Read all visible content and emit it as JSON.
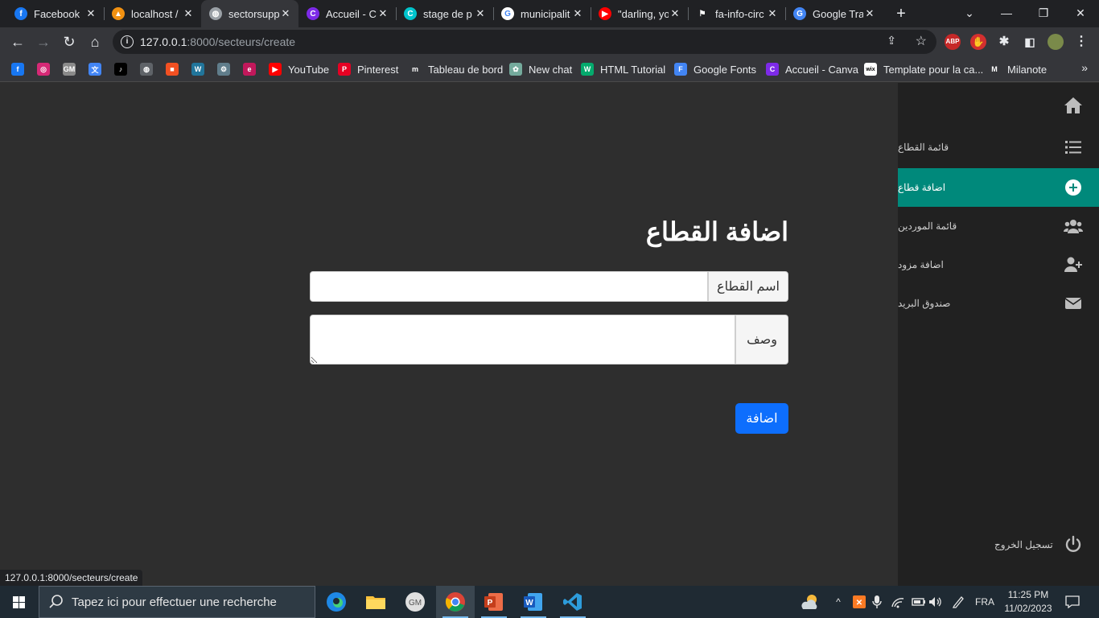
{
  "browser": {
    "tabs": [
      {
        "title": "Facebook",
        "icon": "facebook-icon",
        "color": "#1877f2",
        "glyph": "f"
      },
      {
        "title": "localhost /",
        "icon": "phpmyadmin-icon",
        "color": "#f29111",
        "glyph": "▲"
      },
      {
        "title": "sectorsupp",
        "icon": "globe-icon",
        "color": "#9aa0a6",
        "glyph": "◍",
        "active": true
      },
      {
        "title": "Accueil - C",
        "icon": "canva-icon",
        "color": "#7d2ae8",
        "glyph": "C"
      },
      {
        "title": "stage de p",
        "icon": "canva-icon",
        "color": "#00c4cc",
        "glyph": "C"
      },
      {
        "title": "municipalit",
        "icon": "google-icon",
        "color": "#ffffff",
        "glyph": "G"
      },
      {
        "title": "\"darling, yo",
        "icon": "youtube-icon",
        "color": "#ff0000",
        "glyph": "▶"
      },
      {
        "title": "fa-info-circ",
        "icon": "flag-icon",
        "color": "#202124",
        "glyph": "⚑"
      },
      {
        "title": "Google Tra",
        "icon": "google-translate-icon",
        "color": "#4285f4",
        "glyph": "G"
      }
    ],
    "url": {
      "host": "127.0.0.1",
      "rest": ":8000/secteurs/create"
    },
    "bookmark_icons": [
      {
        "icon": "facebook-icon",
        "color": "#1877f2",
        "glyph": "f"
      },
      {
        "icon": "instagram-icon",
        "color": "#d62976",
        "glyph": "◎"
      },
      {
        "icon": "gmail-icon",
        "color": "#8a8a8a",
        "glyph": "GM"
      },
      {
        "icon": "translate-icon",
        "color": "#4285f4",
        "glyph": "文"
      },
      {
        "icon": "tiktok-icon",
        "color": "#000000",
        "glyph": "♪"
      },
      {
        "icon": "globe-icon",
        "color": "#5f6368",
        "glyph": "◍"
      },
      {
        "icon": "microsoft-icon",
        "color": "#f25022",
        "glyph": "■"
      },
      {
        "icon": "wordpress-icon",
        "color": "#21759b",
        "glyph": "W"
      },
      {
        "icon": "tool-icon",
        "color": "#607d8b",
        "glyph": "⚙"
      },
      {
        "icon": "app-icon",
        "color": "#c2185b",
        "glyph": "e"
      }
    ],
    "bookmarks": [
      {
        "label": "YouTube",
        "icon": "youtube-icon",
        "color": "#ff0000",
        "glyph": "▶"
      },
      {
        "label": "Pinterest",
        "icon": "pinterest-icon",
        "color": "#e60023",
        "glyph": "P"
      },
      {
        "label": "Tableau de bord",
        "icon": "dashboard-icon",
        "color": "#35363a",
        "glyph": "m"
      },
      {
        "label": "New chat",
        "icon": "chatgpt-icon",
        "color": "#74aa9c",
        "glyph": "✿"
      },
      {
        "label": "HTML Tutorial",
        "icon": "w3schools-icon",
        "color": "#04aa6d",
        "glyph": "W"
      },
      {
        "label": "Google Fonts",
        "icon": "google-fonts-icon",
        "color": "#4285f4",
        "glyph": "F"
      },
      {
        "label": "Accueil - Canva",
        "icon": "canva-icon",
        "color": "#7d2ae8",
        "glyph": "C"
      },
      {
        "label": "Template pour la ca...",
        "icon": "wix-icon",
        "color": "#ffffff",
        "glyph": "wix"
      },
      {
        "label": "Milanote",
        "icon": "milanote-icon",
        "color": "#35363a",
        "glyph": "M"
      }
    ]
  },
  "page": {
    "title": "اضافة القطاع",
    "form": {
      "name_label": "اسم القطاع",
      "name_value": "",
      "desc_label": "وصف",
      "desc_value": "",
      "submit_label": "اضافة"
    },
    "status_url": "127.0.0.1:8000/secteurs/create"
  },
  "sidebar": {
    "items": [
      {
        "label": "قائمة القطاع",
        "icon": "list-icon"
      },
      {
        "label": "اضافة قطاع",
        "icon": "plus-circle-icon",
        "active": true
      },
      {
        "label": "قائمة الموردين",
        "icon": "users-icon"
      },
      {
        "label": "اضافة مزود",
        "icon": "user-plus-icon"
      },
      {
        "label": "صندوق البريد",
        "icon": "envelope-icon"
      }
    ],
    "logout_label": "تسجيل الخروج",
    "active_color": "#00897b"
  },
  "taskbar": {
    "search_placeholder": "Tapez ici pour effectuer une recherche",
    "language": "FRA",
    "time": "11:25 PM",
    "date": "11/02/2023"
  }
}
